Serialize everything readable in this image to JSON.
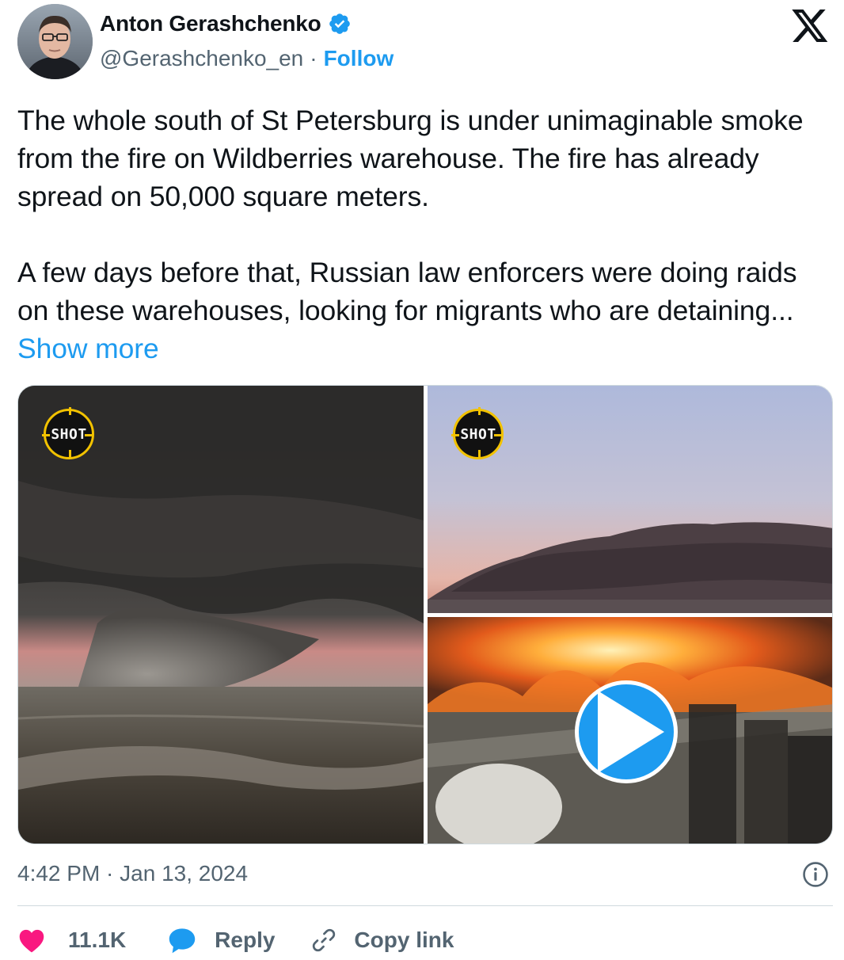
{
  "header": {
    "name": "Anton Gerashchenko",
    "handle": "@Gerashchenko_en",
    "separator": "·",
    "follow_label": "Follow"
  },
  "tweet": {
    "paragraph1": "The whole south of St Petersburg is under unimaginable smoke from the fire on Wildberries warehouse. The fire has already spread on 50,000 square meters.",
    "paragraph2": "A few days before that, Russian law enforcers were doing raids on these warehouses, looking for migrants who are detaining...",
    "show_more": "Show more"
  },
  "media": {
    "watermark": "SHOT"
  },
  "footer": {
    "timestamp": "4:42 PM · Jan 13, 2024",
    "likes": "11.1K",
    "reply_label": "Reply",
    "copy_link_label": "Copy link"
  },
  "colors": {
    "accent": "#1d9bf0",
    "like": "#f91880",
    "muted": "#536471",
    "text": "#0f1419"
  },
  "icons": [
    "verified-badge-icon",
    "x-logo-icon",
    "play-icon",
    "info-icon",
    "heart-icon",
    "reply-bubble-icon",
    "link-icon"
  ]
}
